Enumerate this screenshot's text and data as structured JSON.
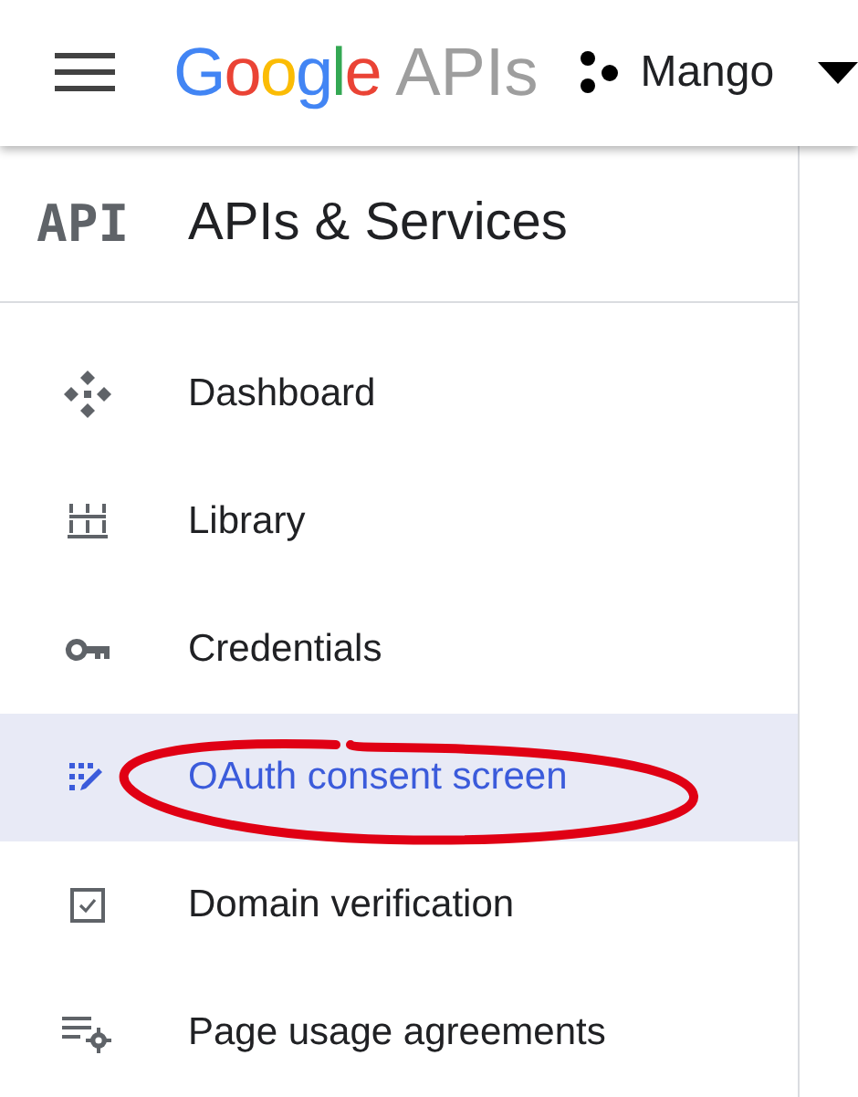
{
  "header": {
    "logo": {
      "brand": "Google",
      "product": "APIs"
    },
    "project": "Mango"
  },
  "sidebar": {
    "badge": "API",
    "title": "APIs & Services",
    "items": [
      {
        "label": "Dashboard",
        "selected": false
      },
      {
        "label": "Library",
        "selected": false
      },
      {
        "label": "Credentials",
        "selected": false
      },
      {
        "label": "OAuth consent screen",
        "selected": true
      },
      {
        "label": "Domain verification",
        "selected": false
      },
      {
        "label": "Page usage agreements",
        "selected": false
      }
    ]
  }
}
